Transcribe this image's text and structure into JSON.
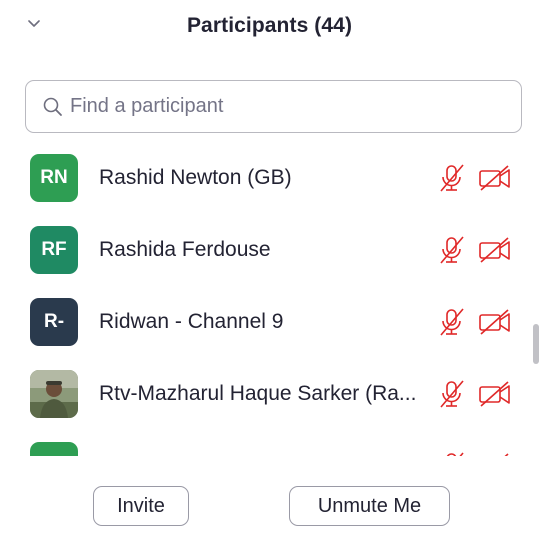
{
  "header": {
    "title": "Participants (44)"
  },
  "search": {
    "placeholder": "Find a participant",
    "value": ""
  },
  "participants": [
    {
      "initials": "RN",
      "name": "Rashid Newton (GB)",
      "avatar_color": "#2e9e53",
      "mic": "muted",
      "video": "off"
    },
    {
      "initials": "RF",
      "name": "Rashida Ferdouse",
      "avatar_color": "#1f8a63",
      "mic": "muted",
      "video": "off"
    },
    {
      "initials": "R-",
      "name": "Ridwan - Channel 9",
      "avatar_color": "#2a3a4d",
      "mic": "muted",
      "video": "off"
    },
    {
      "initials": "",
      "name": "Rtv-Mazharul Haque Sarker (Ra...",
      "avatar_type": "photo",
      "mic": "muted",
      "video": "off"
    },
    {
      "initials": "",
      "name": "",
      "avatar_color": "#2e9e53",
      "mic": "muted",
      "video": "off"
    }
  ],
  "footer": {
    "invite_label": "Invite",
    "unmute_label": "Unmute Me"
  },
  "colors": {
    "muted_red": "#e02828",
    "text": "#232333",
    "border": "#b9b9c0"
  },
  "icons": {
    "collapse": "chevron-down-icon",
    "search": "search-icon",
    "mic": "mic-muted-icon",
    "video": "video-off-icon"
  }
}
